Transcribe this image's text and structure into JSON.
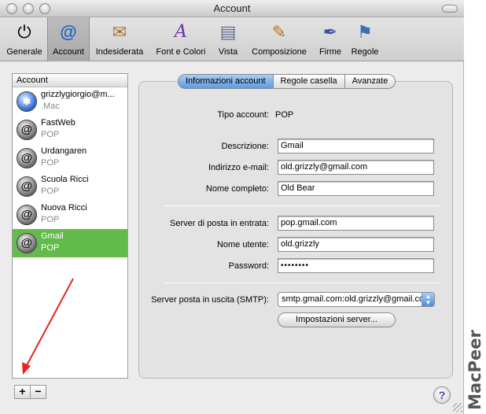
{
  "window": {
    "title": "Account"
  },
  "toolbar": {
    "items": [
      {
        "label": "Generale",
        "icon": "switch-icon",
        "glyph": "⏻"
      },
      {
        "label": "Account",
        "icon": "at-sign-icon",
        "glyph": "@"
      },
      {
        "label": "Indesiderata",
        "icon": "junk-mail-icon",
        "glyph": "✉"
      },
      {
        "label": "Font e Colori",
        "icon": "font-color-icon",
        "glyph": "A"
      },
      {
        "label": "Vista",
        "icon": "view-icon",
        "glyph": "▤"
      },
      {
        "label": "Composizione",
        "icon": "compose-icon",
        "glyph": "✎"
      },
      {
        "label": "Firme",
        "icon": "signature-icon",
        "glyph": "✒"
      },
      {
        "label": "Regole",
        "icon": "rules-icon",
        "glyph": "⚑"
      }
    ],
    "selected": "Account"
  },
  "accounts": {
    "header": "Account",
    "items": [
      {
        "name": "grizzlygiorgio@m...",
        "type": ".Mac",
        "icon": "dotmac-globe-icon",
        "glyph": "✱"
      },
      {
        "name": "FastWeb",
        "type": "POP",
        "icon": "at-sign-icon",
        "glyph": "@"
      },
      {
        "name": "Urdangaren",
        "type": "POP",
        "icon": "at-sign-icon",
        "glyph": "@"
      },
      {
        "name": "Scuola Ricci",
        "type": "POP",
        "icon": "at-sign-icon",
        "glyph": "@"
      },
      {
        "name": "Nuova Ricci",
        "type": "POP",
        "icon": "at-sign-icon",
        "glyph": "@"
      },
      {
        "name": "Gmail",
        "type": "POP",
        "icon": "at-sign-icon",
        "glyph": "@"
      }
    ],
    "selected_index": 5,
    "add_label": "+",
    "remove_label": "−"
  },
  "tabs": [
    {
      "label": "Informazioni account",
      "active": true
    },
    {
      "label": "Regole casella",
      "active": false
    },
    {
      "label": "Avanzate",
      "active": false
    }
  ],
  "form": {
    "account_type_label": "Tipo account:",
    "account_type_value": "POP",
    "description_label": "Descrizione:",
    "description_value": "Gmail",
    "email_label": "Indirizzo e-mail:",
    "email_value": "old.grizzly@gmail.com",
    "fullname_label": "Nome completo:",
    "fullname_value": "Old Bear",
    "incoming_label": "Server di posta in entrata:",
    "incoming_value": "pop.gmail.com",
    "username_label": "Nome utente:",
    "username_value": "old.grizzly",
    "password_label": "Password:",
    "password_value": "••••••••",
    "smtp_label": "Server posta in uscita (SMTP):",
    "smtp_value": "smtp.gmail.com:old.grizzly@gmail.com",
    "server_settings_label": "Impostazioni server..."
  },
  "help": {
    "label": "?"
  },
  "watermark": {
    "text": "MacPeer"
  },
  "colors": {
    "selection": "#63bb4c",
    "tab_active": "#5f9be3",
    "arrow": "#e8261c"
  }
}
